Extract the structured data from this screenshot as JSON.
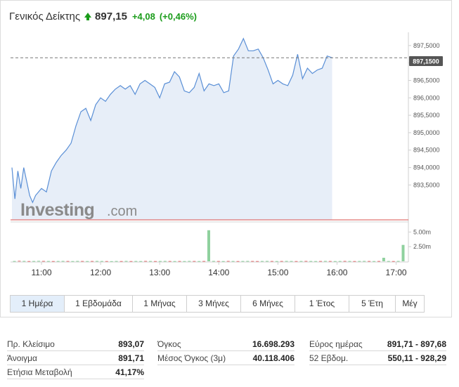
{
  "header": {
    "name": "Γενικός Δείκτης",
    "last": "897,15",
    "change": "+4,08",
    "change_pct": "(+0,46%)",
    "trend_icon": "up-arrow-icon",
    "up_color": "#1a9c1a"
  },
  "logo": {
    "part1": "Investing",
    "part2": ".com"
  },
  "current_label": "897,1500",
  "tabs": [
    {
      "label": "1 Ημέρα",
      "active": true
    },
    {
      "label": "1 Εβδομάδα",
      "active": false
    },
    {
      "label": "1 Μήνας",
      "active": false
    },
    {
      "label": "3 Μήνες",
      "active": false
    },
    {
      "label": "6 Μήνες",
      "active": false
    },
    {
      "label": "1 Έτος",
      "active": false
    },
    {
      "label": "5 Έτη",
      "active": false
    },
    {
      "label": "Μέγ",
      "active": false
    }
  ],
  "stats": [
    [
      {
        "label": "Πρ. Κλείσιμο",
        "value": "893,07"
      },
      {
        "label": "Άνοιγμα",
        "value": "891,71"
      },
      {
        "label": "Ετήσια Μεταβολή",
        "value": "41,17%"
      }
    ],
    [
      {
        "label": "Όγκος",
        "value": "16.698.293"
      },
      {
        "label": "Μέσος Όγκος (3μ)",
        "value": "40.118.406"
      }
    ],
    [
      {
        "label": "Εύρος ημέρας",
        "value": "891,71 - 897,68"
      },
      {
        "label": "52 Εβδομ.",
        "value": "550,11 - 928,29"
      }
    ]
  ],
  "chart_data": {
    "type": "area",
    "price_series": {
      "x": [
        "10:30",
        "10:33",
        "10:36",
        "10:39",
        "10:42",
        "10:45",
        "10:48",
        "10:51",
        "10:54",
        "10:57",
        "11:00",
        "11:05",
        "11:10",
        "11:15",
        "11:20",
        "11:25",
        "11:30",
        "11:35",
        "11:40",
        "11:45",
        "11:50",
        "11:55",
        "12:00",
        "12:05",
        "12:10",
        "12:15",
        "12:20",
        "12:25",
        "12:30",
        "12:35",
        "12:40",
        "12:45",
        "12:50",
        "12:55",
        "13:00",
        "13:05",
        "13:10",
        "13:15",
        "13:20",
        "13:25",
        "13:30",
        "13:35",
        "13:40",
        "13:45",
        "13:50",
        "13:55",
        "14:00",
        "14:05",
        "14:10",
        "14:15",
        "14:20",
        "14:25",
        "14:30",
        "14:35",
        "14:40",
        "14:45",
        "14:50",
        "14:55",
        "15:00",
        "15:05",
        "15:10",
        "15:15",
        "15:20",
        "15:25",
        "15:30",
        "15:35",
        "15:40",
        "15:45",
        "15:50",
        "15:55",
        "16:00",
        "16:05",
        "16:10",
        "16:15",
        "16:20",
        "16:25",
        "16:30",
        "16:35",
        "16:40",
        "16:45",
        "16:50",
        "16:55",
        "17:00",
        "17:05",
        "17:10"
      ],
      "y": [
        894.0,
        893.1,
        893.9,
        893.4,
        894.0,
        893.6,
        893.2,
        893.0,
        893.2,
        893.3,
        893.4,
        893.3,
        893.9,
        894.15,
        894.35,
        894.5,
        894.7,
        895.2,
        895.6,
        895.7,
        895.35,
        895.8,
        896.0,
        895.9,
        896.1,
        896.25,
        896.35,
        896.25,
        896.35,
        896.1,
        896.4,
        896.5,
        896.4,
        896.3,
        896.0,
        896.4,
        896.45,
        896.75,
        896.6,
        896.2,
        896.15,
        896.3,
        896.7,
        896.2,
        896.4,
        896.35,
        896.4,
        896.15,
        896.2,
        897.2,
        897.4,
        897.7,
        897.35,
        897.35,
        897.4,
        897.15,
        896.8,
        896.4,
        896.5,
        896.4,
        896.35,
        896.65,
        897.25,
        896.55,
        896.85,
        896.7,
        896.8,
        896.85,
        897.2,
        897.15
      ],
      "ylim": [
        892.5,
        897.9
      ]
    },
    "volume_series": {
      "values": [
        0.05,
        0.08,
        0.06,
        0.04,
        0.05,
        0.07,
        0.06,
        0.05,
        0.04,
        0.05,
        0.06,
        0.05,
        0.04,
        0.06,
        0.05,
        0.04,
        0.05,
        0.06,
        0.05,
        0.04,
        0.03,
        0.05,
        0.04,
        0.06,
        0.04,
        0.05,
        0.04,
        0.06,
        0.05,
        0.04,
        0.05,
        0.06,
        0.05,
        0.04,
        0.05,
        0.04,
        0.06,
        0.05,
        0.04,
        0.05,
        5.3,
        0.06,
        0.05,
        0.04,
        0.06,
        0.05,
        0.04,
        0.05,
        0.06,
        0.05,
        0.04,
        0.05,
        0.06,
        0.05,
        0.04,
        0.05,
        0.06,
        0.05,
        0.04,
        0.05,
        0.06,
        0.05,
        0.04,
        0.05,
        0.06,
        0.05,
        0.04,
        0.05,
        0.06,
        0.05,
        0.04,
        0.05,
        0.06,
        0.05,
        0.04,
        0.05,
        0.6,
        0.05,
        0.04,
        0.06,
        2.8
      ],
      "directions": [
        "u",
        "d",
        "u",
        "d",
        "u",
        "u",
        "d",
        "u",
        "d",
        "u",
        "u",
        "d",
        "u",
        "u",
        "d",
        "u",
        "d",
        "u",
        "u",
        "d",
        "u",
        "u",
        "d",
        "u",
        "d",
        "u",
        "u",
        "d",
        "u",
        "d",
        "u",
        "u",
        "d",
        "u",
        "d",
        "u",
        "u",
        "d",
        "u",
        "d",
        "u",
        "u",
        "d",
        "u",
        "d",
        "u",
        "d",
        "u",
        "u",
        "d",
        "d",
        "u",
        "u",
        "d",
        "u",
        "d",
        "u",
        "u",
        "d",
        "u",
        "d",
        "u",
        "u",
        "d",
        "u",
        "d",
        "u",
        "u",
        "d",
        "u",
        "d",
        "u",
        "u",
        "d",
        "u",
        "d",
        "u",
        "u",
        "d",
        "u",
        "u"
      ],
      "ylim": [
        0,
        6.0
      ],
      "up_color": "#8fd19e",
      "down_color": "#e57373"
    },
    "price_ticks": [
      "893,5000",
      "894,0000",
      "894,5000",
      "895,0000",
      "895,5000",
      "896,0000",
      "896,5000",
      "897,0000",
      "897,5000"
    ],
    "price_tick_values": [
      893.5,
      894.0,
      894.5,
      895.0,
      895.5,
      896.0,
      896.5,
      897.0,
      897.5
    ],
    "volume_ticks": [
      "2.50m",
      "5.00m"
    ],
    "volume_tick_values": [
      2.5,
      5.0
    ],
    "x_ticks": [
      "11:00",
      "12:00",
      "13:00",
      "14:00",
      "15:00",
      "16:00",
      "17:00"
    ],
    "x_tick_values": [
      11,
      12,
      13,
      14,
      15,
      16,
      17
    ],
    "x_range": [
      10.5,
      17.16
    ],
    "current_value": 897.15,
    "reference_line": 892.5,
    "line_color": "#5a8fd6",
    "fill_color": "#e7eef8",
    "reference_color": "#d9534f"
  }
}
